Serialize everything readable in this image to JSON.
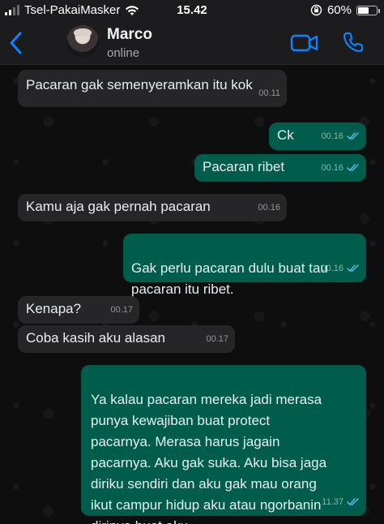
{
  "status_bar": {
    "carrier": "Tsel-PakaiMasker",
    "time": "15.42",
    "battery": "60%",
    "battery_level": 0.6
  },
  "header": {
    "name": "Marco",
    "status": "online",
    "icons": [
      "back-chevron-icon",
      "avatar",
      "video-call-icon",
      "voice-call-icon"
    ]
  },
  "messages": [
    {
      "dir": "in",
      "text": "Pacaran gak semenyeramkan itu kok",
      "time": "00.11"
    },
    {
      "dir": "out",
      "text": "Ck",
      "time": "00.16",
      "read": true
    },
    {
      "dir": "out",
      "text": "Pacaran ribet",
      "time": "00.16",
      "read": true
    },
    {
      "dir": "in",
      "text": "Kamu aja gak pernah pacaran",
      "time": "00.16"
    },
    {
      "dir": "out",
      "text": "Gak perlu pacaran dulu buat tau\npacaran itu ribet.",
      "time": "00.16",
      "read": true
    },
    {
      "dir": "in",
      "text": "Kenapa?",
      "time": "00.17"
    },
    {
      "dir": "in",
      "text": "Coba kasih aku alasan",
      "time": "00.17"
    },
    {
      "dir": "out",
      "text": "Ya kalau pacaran mereka jadi merasa\npunya kewajiban buat protect\npacarnya. Merasa harus jagain\npacarnya. Aku gak suka. Aku bisa jaga\ndiriku sendiri dan aku gak mau orang\nikut campur hidup aku atau ngorbanin\ndirinya buat aku.",
      "time": "11.37",
      "read": true
    }
  ],
  "colors": {
    "incoming_bubble": "#262628",
    "outgoing_bubble": "#005c4b",
    "accent": "#0a84ff",
    "read_ticks": "#53bdeb"
  }
}
